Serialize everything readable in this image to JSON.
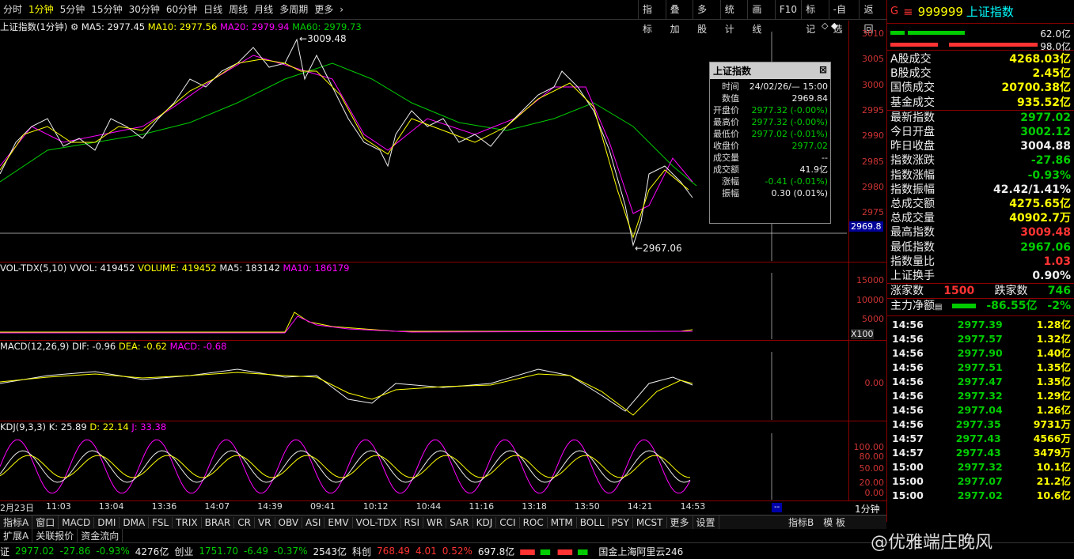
{
  "toolbar": {
    "periods": [
      "分时",
      "1分钟",
      "5分钟",
      "15分钟",
      "30分钟",
      "60分钟",
      "日线",
      "周线",
      "月线",
      "多周期",
      "更多"
    ],
    "selected": 1,
    "tools": [
      "指标",
      "叠加",
      "多股",
      "统计",
      "画线",
      "F10",
      "标记",
      "-自选",
      "返回"
    ]
  },
  "main_chart": {
    "title": "上证指数(1分钟)",
    "ma5": "MA5: 2977.45",
    "ma10": "MA10: 2977.56",
    "ma20": "MA20: 2979.94",
    "ma60": "MA60: 2979.73",
    "high_label": "3009.48",
    "low_label": "2967.06",
    "cursor_price": "2969.8",
    "yaxis": [
      "3010",
      "3005",
      "3000",
      "2995",
      "2990",
      "2985",
      "2980",
      "2975"
    ]
  },
  "tooltip": {
    "title": "上证指数",
    "rows": [
      {
        "k": "时间",
        "v": "24/02/26/— 15:00",
        "c": "w"
      },
      {
        "k": "数值",
        "v": "2969.84",
        "c": "w"
      },
      {
        "k": "开盘价",
        "v": "2977.32 (-0.00%)",
        "c": "g"
      },
      {
        "k": "最高价",
        "v": "2977.32 (-0.00%)",
        "c": "g"
      },
      {
        "k": "最低价",
        "v": "2977.02 (-0.01%)",
        "c": "g"
      },
      {
        "k": "收盘价",
        "v": "2977.02",
        "c": "g"
      },
      {
        "k": "成交量",
        "v": "--",
        "c": "w"
      },
      {
        "k": "成交额",
        "v": "41.9亿",
        "c": "w"
      },
      {
        "k": "涨幅",
        "v": "-0.41 (-0.01%)",
        "c": "g"
      },
      {
        "k": "振幅",
        "v": "0.30 (0.01%)",
        "c": "w"
      }
    ]
  },
  "volume": {
    "title": "VOL-TDX(5,10)",
    "vvol": "VVOL: 419452",
    "volume": "VOLUME: 419452",
    "ma5": "MA5: 183142",
    "ma10": "MA10: 186179",
    "yaxis": [
      "15000",
      "10000",
      "5000"
    ],
    "unit": "X100"
  },
  "macd": {
    "title": "MACD(12,26,9)",
    "dif": "DIF: -0.96",
    "dea": "DEA: -0.62",
    "macd": "MACD: -0.68",
    "zero": "0.00"
  },
  "kdj": {
    "title": "KDJ(9,3,3)",
    "k": "K: 25.89",
    "d": "D: 22.14",
    "j": "J: 33.38",
    "yaxis": [
      "100.00",
      "80.00",
      "50.00",
      "20.00",
      "0.00"
    ]
  },
  "xaxis": [
    "2月23日",
    "11:03",
    "13:04",
    "13:36",
    "14:07",
    "14:39",
    "09:41",
    "10:12",
    "10:44",
    "11:16",
    "13:18",
    "13:50",
    "14:21",
    "14:53"
  ],
  "period_label": "1分钟",
  "right_panel": {
    "code": "999999",
    "name": "上证指数",
    "bar_values": [
      "62.0亿",
      "98.0亿"
    ],
    "stats": [
      {
        "k": "A股成交",
        "v": "4268.03亿",
        "c": "y"
      },
      {
        "k": "B股成交",
        "v": "2.45亿",
        "c": "y"
      },
      {
        "k": "国债成交",
        "v": "20700.38亿",
        "c": "y"
      },
      {
        "k": "基金成交",
        "v": "935.52亿",
        "c": "y"
      },
      {
        "k": "最新指数",
        "v": "2977.02",
        "c": "g"
      },
      {
        "k": "今日开盘",
        "v": "3002.12",
        "c": "g"
      },
      {
        "k": "昨日收盘",
        "v": "3004.88",
        "c": "w"
      },
      {
        "k": "指数涨跌",
        "v": "-27.86",
        "c": "g"
      },
      {
        "k": "指数涨幅",
        "v": "-0.93%",
        "c": "g"
      },
      {
        "k": "指数振幅",
        "v": "42.42/1.41%",
        "c": "w"
      },
      {
        "k": "总成交额",
        "v": "4275.65亿",
        "c": "y"
      },
      {
        "k": "总成交量",
        "v": "40902.7万",
        "c": "y"
      },
      {
        "k": "最高指数",
        "v": "3009.48",
        "c": "r"
      },
      {
        "k": "最低指数",
        "v": "2967.06",
        "c": "g"
      },
      {
        "k": "指数量比",
        "v": "1.03",
        "c": "r"
      },
      {
        "k": "上证换手",
        "v": "0.90%",
        "c": "w"
      }
    ],
    "up_label": "涨家数",
    "up_value": "1500",
    "down_label": "跌家数",
    "down_value": "746",
    "main_flow_label": "主力净额",
    "main_flow_value": "-86.55亿",
    "main_flow_pct": "-2%",
    "ticks": [
      {
        "t": "14:56",
        "p": "2977.39",
        "v": "1.28亿"
      },
      {
        "t": "14:56",
        "p": "2977.57",
        "v": "1.32亿"
      },
      {
        "t": "14:56",
        "p": "2977.90",
        "v": "1.40亿"
      },
      {
        "t": "14:56",
        "p": "2977.51",
        "v": "1.35亿"
      },
      {
        "t": "14:56",
        "p": "2977.47",
        "v": "1.35亿"
      },
      {
        "t": "14:56",
        "p": "2977.32",
        "v": "1.29亿"
      },
      {
        "t": "14:56",
        "p": "2977.04",
        "v": "1.26亿"
      },
      {
        "t": "14:56",
        "p": "2977.35",
        "v": "9731万"
      },
      {
        "t": "14:57",
        "p": "2977.43",
        "v": "4566万"
      },
      {
        "t": "14:57",
        "p": "2977.43",
        "v": "3479万"
      },
      {
        "t": "15:00",
        "p": "2977.32",
        "v": "10.1亿"
      },
      {
        "t": "15:00",
        "p": "2977.07",
        "v": "21.2亿"
      },
      {
        "t": "15:00",
        "p": "2977.02",
        "v": "10.6亿"
      }
    ]
  },
  "tabs": [
    "指标A",
    "窗口",
    "MACD",
    "DMI",
    "DMA",
    "FSL",
    "TRIX",
    "BRAR",
    "CR",
    "VR",
    "OBV",
    "ASI",
    "EMV",
    "VOL-TDX",
    "RSI",
    "WR",
    "SAR",
    "KDJ",
    "CCI",
    "ROC",
    "MTM",
    "BOLL",
    "PSY",
    "MCST",
    "更多",
    "设置"
  ],
  "tabs_right": [
    "指标B",
    "模 板"
  ],
  "tabs2": [
    "扩展A",
    "关联报价",
    "资金流向"
  ],
  "status": {
    "sh_name": "证",
    "sh_val": "2977.02",
    "sh_chg": "-27.86",
    "sh_pct": "-0.93%",
    "sh_amt": "4276亿",
    "cy_name": "创业",
    "cy_val": "1751.70",
    "cy_chg": "-6.49",
    "cy_pct": "-0.37%",
    "cy_amt": "2543亿",
    "kc_name": "科创",
    "kc_val": "768.49",
    "kc_chg": "4.01",
    "kc_pct": "0.52%",
    "kc_amt": "697.8亿",
    "server": "国金上海阿里云246"
  },
  "watermark": "@优雅端庄晚风"
}
